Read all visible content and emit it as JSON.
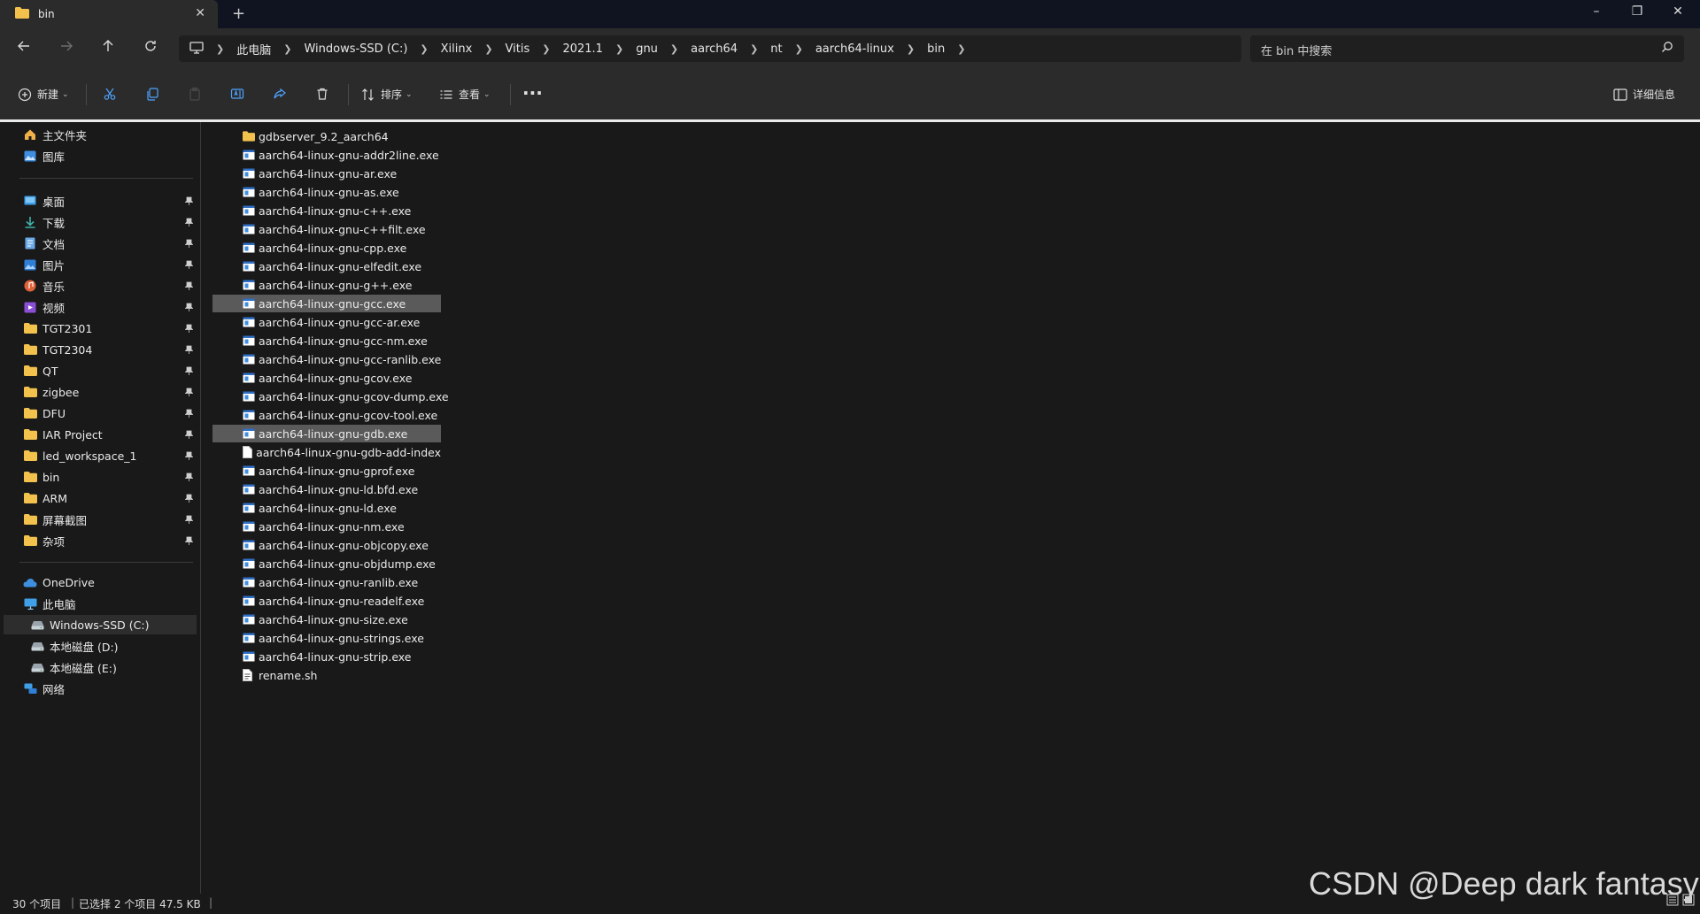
{
  "tab": {
    "title": "bin",
    "new_tab": "+",
    "close": "✕"
  },
  "window_controls": {
    "minimize": "–",
    "restore": "❐",
    "close": "✕"
  },
  "breadcrumb": [
    "此电脑",
    "Windows-SSD (C:)",
    "Xilinx",
    "Vitis",
    "2021.1",
    "gnu",
    "aarch64",
    "nt",
    "aarch64-linux",
    "bin"
  ],
  "search": {
    "placeholder": "在 bin 中搜索"
  },
  "toolbar": {
    "new_label": "新建",
    "sort_label": "排序",
    "view_label": "查看",
    "more_label": "···",
    "details_label": "详细信息"
  },
  "sidebar": {
    "top": [
      {
        "label": "主文件夹",
        "icon": "home-icon"
      },
      {
        "label": "图库",
        "icon": "gallery-icon"
      }
    ],
    "pinned": [
      {
        "label": "桌面",
        "icon": "desktop-icon"
      },
      {
        "label": "下载",
        "icon": "download-icon"
      },
      {
        "label": "文档",
        "icon": "document-icon"
      },
      {
        "label": "图片",
        "icon": "pictures-icon"
      },
      {
        "label": "音乐",
        "icon": "music-icon"
      },
      {
        "label": "视频",
        "icon": "video-icon"
      },
      {
        "label": "TGT2301",
        "icon": "folder-icon"
      },
      {
        "label": "TGT2304",
        "icon": "folder-icon"
      },
      {
        "label": "QT",
        "icon": "folder-icon"
      },
      {
        "label": "zigbee",
        "icon": "folder-icon"
      },
      {
        "label": "DFU",
        "icon": "folder-icon"
      },
      {
        "label": "IAR Project",
        "icon": "folder-icon"
      },
      {
        "label": "led_workspace_1",
        "icon": "folder-icon"
      },
      {
        "label": "bin",
        "icon": "folder-icon"
      },
      {
        "label": "ARM",
        "icon": "folder-icon"
      },
      {
        "label": "屏幕截图",
        "icon": "folder-icon"
      },
      {
        "label": "杂项",
        "icon": "folder-icon"
      }
    ],
    "locations": [
      {
        "label": "OneDrive",
        "icon": "cloud-icon"
      },
      {
        "label": "此电脑",
        "icon": "computer-icon"
      },
      {
        "label": "Windows-SSD (C:)",
        "icon": "drive-icon",
        "selected": true
      },
      {
        "label": "本地磁盘 (D:)",
        "icon": "drive-icon"
      },
      {
        "label": "本地磁盘 (E:)",
        "icon": "drive-icon"
      },
      {
        "label": "网络",
        "icon": "network-icon"
      }
    ]
  },
  "files": [
    {
      "name": "gdbserver_9.2_aarch64",
      "type": "folder"
    },
    {
      "name": "aarch64-linux-gnu-addr2line.exe",
      "type": "exe"
    },
    {
      "name": "aarch64-linux-gnu-ar.exe",
      "type": "exe"
    },
    {
      "name": "aarch64-linux-gnu-as.exe",
      "type": "exe"
    },
    {
      "name": "aarch64-linux-gnu-c++.exe",
      "type": "exe"
    },
    {
      "name": "aarch64-linux-gnu-c++filt.exe",
      "type": "exe"
    },
    {
      "name": "aarch64-linux-gnu-cpp.exe",
      "type": "exe"
    },
    {
      "name": "aarch64-linux-gnu-elfedit.exe",
      "type": "exe"
    },
    {
      "name": "aarch64-linux-gnu-g++.exe",
      "type": "exe"
    },
    {
      "name": "aarch64-linux-gnu-gcc.exe",
      "type": "exe",
      "selected": true
    },
    {
      "name": "aarch64-linux-gnu-gcc-ar.exe",
      "type": "exe"
    },
    {
      "name": "aarch64-linux-gnu-gcc-nm.exe",
      "type": "exe"
    },
    {
      "name": "aarch64-linux-gnu-gcc-ranlib.exe",
      "type": "exe"
    },
    {
      "name": "aarch64-linux-gnu-gcov.exe",
      "type": "exe"
    },
    {
      "name": "aarch64-linux-gnu-gcov-dump.exe",
      "type": "exe"
    },
    {
      "name": "aarch64-linux-gnu-gcov-tool.exe",
      "type": "exe"
    },
    {
      "name": "aarch64-linux-gnu-gdb.exe",
      "type": "exe",
      "selected": true
    },
    {
      "name": "aarch64-linux-gnu-gdb-add-index",
      "type": "file"
    },
    {
      "name": "aarch64-linux-gnu-gprof.exe",
      "type": "exe"
    },
    {
      "name": "aarch64-linux-gnu-ld.bfd.exe",
      "type": "exe"
    },
    {
      "name": "aarch64-linux-gnu-ld.exe",
      "type": "exe"
    },
    {
      "name": "aarch64-linux-gnu-nm.exe",
      "type": "exe"
    },
    {
      "name": "aarch64-linux-gnu-objcopy.exe",
      "type": "exe"
    },
    {
      "name": "aarch64-linux-gnu-objdump.exe",
      "type": "exe"
    },
    {
      "name": "aarch64-linux-gnu-ranlib.exe",
      "type": "exe"
    },
    {
      "name": "aarch64-linux-gnu-readelf.exe",
      "type": "exe"
    },
    {
      "name": "aarch64-linux-gnu-size.exe",
      "type": "exe"
    },
    {
      "name": "aarch64-linux-gnu-strings.exe",
      "type": "exe"
    },
    {
      "name": "aarch64-linux-gnu-strip.exe",
      "type": "exe"
    },
    {
      "name": "rename.sh",
      "type": "script"
    }
  ],
  "status": {
    "item_count": "30 个项目",
    "selection": "已选择 2 个项目  47.5 KB"
  },
  "watermark": "CSDN @Deep dark fantasy",
  "colors": {
    "folder": "#f3c24d",
    "exe": "#3f8fe0",
    "selected": "#5a5a5a"
  }
}
